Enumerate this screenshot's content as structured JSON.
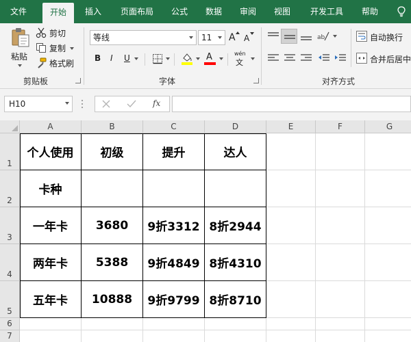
{
  "ribbon_tabs": [
    "文件",
    "开始",
    "插入",
    "页面布局",
    "公式",
    "数据",
    "审阅",
    "视图",
    "开发工具",
    "帮助"
  ],
  "active_tab_index": 1,
  "clipboard": {
    "paste_label": "粘贴",
    "cut_label": "剪切",
    "copy_label": "复制",
    "format_painter_label": "格式刷",
    "group_label": "剪贴板"
  },
  "font": {
    "font_name": "等线",
    "font_size": "11",
    "grow_label": "A",
    "shrink_label": "A",
    "bold_label": "B",
    "italic_label": "I",
    "underline_label": "U",
    "font_color_label": "A",
    "phonetic_label": "wén",
    "phonetic_sub": "文",
    "group_label": "字体"
  },
  "alignment": {
    "wrap_text_label": "自动换行",
    "merge_center_label": "合并后居中",
    "group_label": "对齐方式"
  },
  "formula_bar": {
    "name_box": "H10",
    "fx_label": "fx",
    "formula": ""
  },
  "columns": [
    "A",
    "B",
    "C",
    "D",
    "E",
    "F",
    "G"
  ],
  "rows": [
    "1",
    "2",
    "3",
    "4",
    "5",
    "6",
    "7"
  ],
  "table": [
    [
      "个人使用",
      "初级",
      "提升",
      "达人"
    ],
    [
      "卡种",
      "",
      "",
      ""
    ],
    [
      "一年卡",
      "3680",
      "9折3312",
      "8折2944"
    ],
    [
      "两年卡",
      "5388",
      "9折4849",
      "8折4310"
    ],
    [
      "五年卡",
      "10888",
      "9折9799",
      "8折8710"
    ]
  ],
  "colors": {
    "ribbon_green": "#217346",
    "highlight_yellow": "#ffff00",
    "font_red": "#ff0000"
  }
}
